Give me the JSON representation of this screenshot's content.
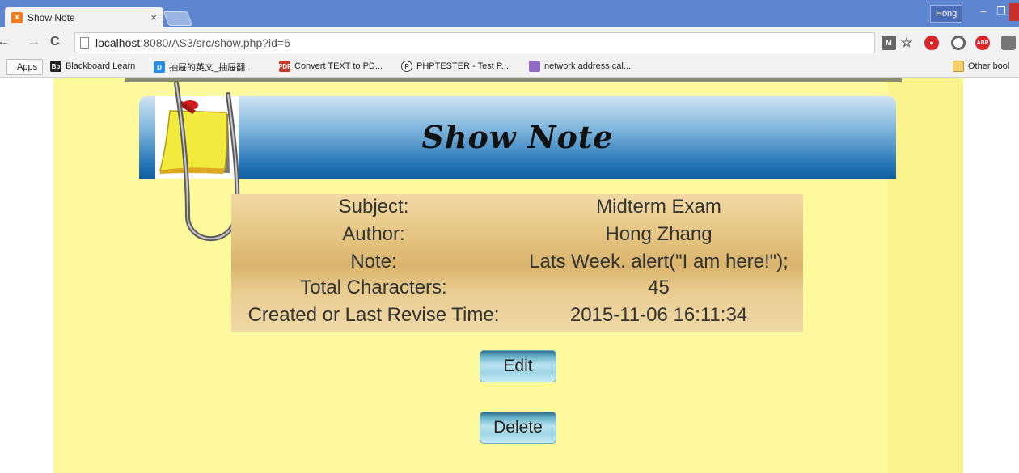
{
  "browser": {
    "tab_title": "Show Note",
    "tab_close": "×",
    "profile_name": "Hong",
    "url_host": "localhost",
    "url_rest": ":8080/AS3/src/show.php?id=6",
    "bookmarks": [
      {
        "label": "Apps",
        "icon": "apps-icon"
      },
      {
        "label": "Blackboard Learn",
        "icon": "blackboard-icon"
      },
      {
        "label": "抽屉的英文_抽屉翻...",
        "icon": "dict-icon"
      },
      {
        "label": "Convert TEXT to PD...",
        "icon": "pdf-icon"
      },
      {
        "label": "PHPTESTER - Test P...",
        "icon": "phptester-icon"
      },
      {
        "label": "network address cal...",
        "icon": "network-icon"
      }
    ],
    "other_bookmarks": "Other bool"
  },
  "page": {
    "title": "Show Note",
    "fields": [
      {
        "label": "Subject:",
        "value": "Midterm Exam"
      },
      {
        "label": "Author:",
        "value": "Hong Zhang"
      },
      {
        "label": "Note:",
        "value": "Lats Week. alert(\"I am here!\");"
      },
      {
        "label": "Total Characters:",
        "value": "45"
      },
      {
        "label": "Created or Last Revise Time:",
        "value": "2015-11-06 16:11:34"
      }
    ],
    "edit_label": "Edit",
    "delete_label": "Delete"
  },
  "colors": {
    "header_blue": "#2b79b8",
    "note_yellow": "#fdf99c",
    "info_tan": "#e3c27d"
  }
}
